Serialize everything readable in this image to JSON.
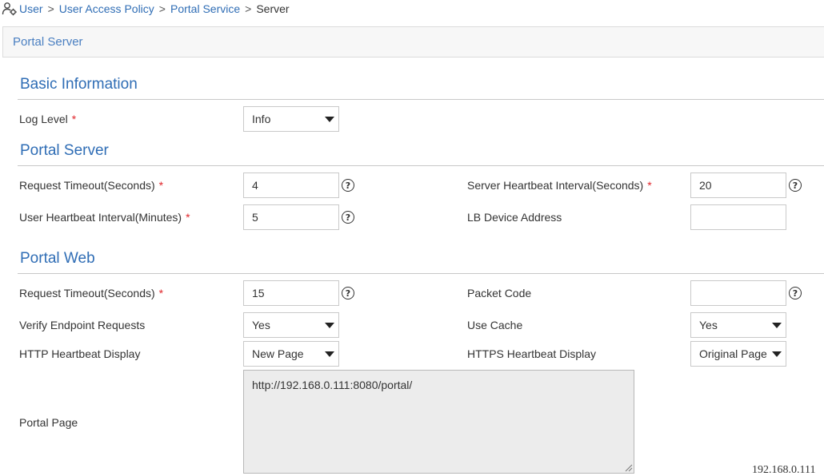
{
  "breadcrumb": {
    "icon": "user-gear-icon",
    "items": [
      "User",
      "User Access Policy",
      "Portal Service"
    ],
    "separator": ">",
    "current": "Server"
  },
  "panel": {
    "title": "Portal Server"
  },
  "sections": {
    "basic": {
      "title": "Basic Information",
      "log_level": {
        "label": "Log Level",
        "required": "*",
        "value": "Info"
      }
    },
    "portal_server": {
      "title": "Portal Server",
      "request_timeout": {
        "label": "Request Timeout(Seconds)",
        "required": "*",
        "value": "4"
      },
      "server_heartbeat": {
        "label": "Server Heartbeat Interval(Seconds)",
        "required": "*",
        "value": "20"
      },
      "user_heartbeat": {
        "label": "User Heartbeat Interval(Minutes)",
        "required": "*",
        "value": "5"
      },
      "lb_device": {
        "label": "LB Device Address",
        "value": ""
      }
    },
    "portal_web": {
      "title": "Portal Web",
      "request_timeout": {
        "label": "Request Timeout(Seconds)",
        "required": "*",
        "value": "15"
      },
      "packet_code": {
        "label": "Packet Code",
        "value": ""
      },
      "verify_endpoint": {
        "label": "Verify Endpoint Requests",
        "value": "Yes"
      },
      "use_cache": {
        "label": "Use Cache",
        "value": "Yes"
      },
      "http_heartbeat": {
        "label": "HTTP Heartbeat Display",
        "value": "New Page"
      },
      "https_heartbeat": {
        "label": "HTTPS Heartbeat Display",
        "value": "Original Page"
      },
      "portal_page": {
        "label": "Portal Page",
        "value": "http://192.168.0.111:8080/portal/"
      }
    }
  },
  "help_glyph": "?",
  "footer": {
    "ip": "192.168.0.111"
  },
  "colors": {
    "accent": "#2f6db5",
    "required": "#e0262b",
    "textarea_bg": "#ececec"
  }
}
